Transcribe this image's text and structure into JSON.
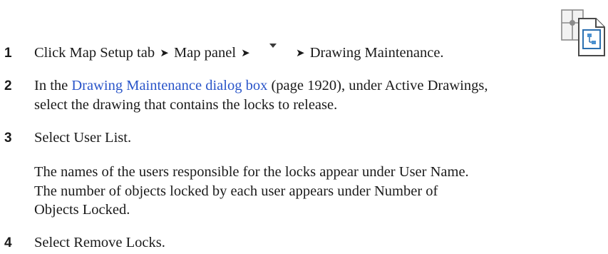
{
  "steps": [
    {
      "number": "1",
      "segments": [
        "Click Map Setup tab",
        "Map panel",
        "Drawing Maintenance."
      ],
      "arrow": "➤",
      "icons": [
        "dropdown-arrow-icon",
        "drawing-maintenance-icon"
      ]
    },
    {
      "number": "2",
      "prefix": "In the",
      "link": "Drawing Maintenance dialog box",
      "ref": "(page 1920), under Active Drawings,",
      "line2": "select the drawing that contains the locks to release."
    },
    {
      "number": "3",
      "text": "Select User List.",
      "para": [
        "The names of the users responsible for the locks appear under User Name.",
        "The number of objects locked by each user appears under Number of",
        "Objects Locked."
      ]
    },
    {
      "number": "4",
      "text": "Select Remove Locks."
    }
  ],
  "colors": {
    "text": "#1a1a1a",
    "link": "#2a55c9"
  }
}
